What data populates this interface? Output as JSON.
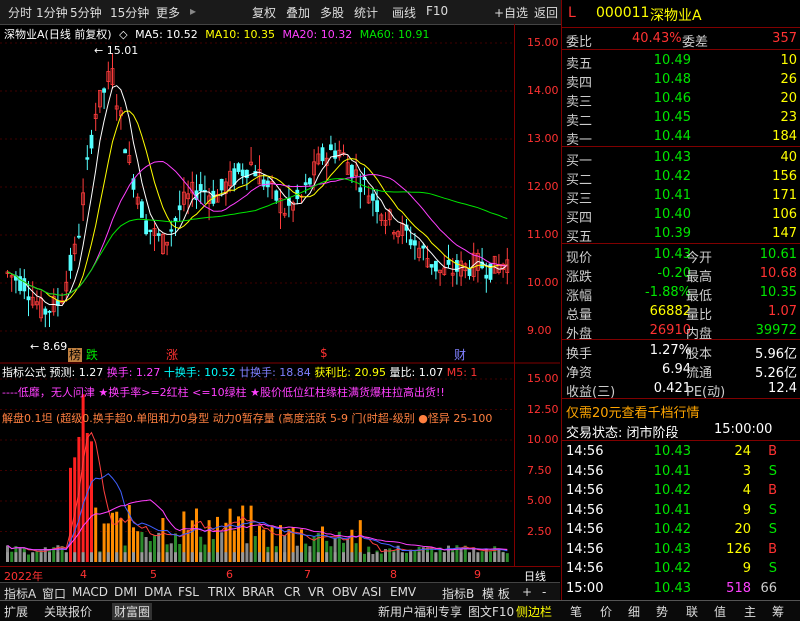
{
  "toolbar": {
    "items": [
      "分时",
      "1分钟",
      "5分钟",
      "15分钟",
      "更多",
      "复权",
      "叠加",
      "多股",
      "统计",
      "画线",
      "F10",
      "+自选",
      "返回"
    ]
  },
  "quote_header": {
    "prefix": "L",
    "code": "000011",
    "name": "深物业A"
  },
  "chart_header": {
    "title": "深物业A(日线 前复权)",
    "ma5": "MA5: 10.52",
    "ma10": "MA10: 10.35",
    "ma20": "MA20: 10.32",
    "ma60": "MA60: 10.91"
  },
  "price_axis": [
    "15.00",
    "14.00",
    "13.00",
    "12.00",
    "11.00",
    "10.00",
    "9.00"
  ],
  "annotations": {
    "high": "15.01",
    "low": "8.69"
  },
  "markers": [
    "榜",
    "跌",
    "涨",
    "$",
    "财"
  ],
  "indicator_header": {
    "name": "指标公式",
    "pred": "预测: 1.27",
    "hs": "换手: 1.27",
    "hs10": "十换手: 10.52",
    "hs20": "廿换手: 18.84",
    "profit": "获利比: 20.95",
    "lb": "量比: 1.07",
    "m5": "M5: 1"
  },
  "indicator_axis": [
    "15.00",
    "12.50",
    "10.00",
    "7.50",
    "5.00",
    "2.50"
  ],
  "indicator_notes": {
    "line1": "----低靡，无人问津 ★换手率>=2红柱 <=10绿柱 ★股价低位红柱缘柱满货爆柱拉高出货!!",
    "line2": "解盘0.1坦 (超级0.换手超0.单阻和力0身型 动力0暂存量 (高度活跃 5-9 门(时超-级别 ●怪异 25-100"
  },
  "time_axis": [
    "2022年",
    "4",
    "5",
    "6",
    "7",
    "8",
    "9",
    "日线"
  ],
  "tabs": [
    "指标A",
    "窗口",
    "MACD",
    "DMI",
    "DMA",
    "FSL",
    "TRIX",
    "BRAR",
    "CR",
    "VR",
    "OBV",
    "ASI",
    "EMV",
    "指标B",
    "模 板",
    "+",
    "-"
  ],
  "footer": {
    "left": [
      "扩展",
      "关联报价",
      "财富圈"
    ],
    "center": [
      "新用户福利专享",
      "图文F10",
      "侧边栏"
    ],
    "right": [
      "笔",
      "价",
      "细",
      "势",
      "联",
      "值",
      "主",
      "筹"
    ]
  },
  "order_book": {
    "wb_label": "委比",
    "wb_value": "40.43%",
    "wc_label": "委差",
    "wc_value": "357",
    "sells": [
      {
        "label": "卖五",
        "price": "10.49",
        "vol": "10"
      },
      {
        "label": "卖四",
        "price": "10.48",
        "vol": "26"
      },
      {
        "label": "卖三",
        "price": "10.46",
        "vol": "20"
      },
      {
        "label": "卖二",
        "price": "10.45",
        "vol": "23"
      },
      {
        "label": "卖一",
        "price": "10.44",
        "vol": "184"
      }
    ],
    "buys": [
      {
        "label": "买一",
        "price": "10.43",
        "vol": "40"
      },
      {
        "label": "买二",
        "price": "10.42",
        "vol": "156"
      },
      {
        "label": "买三",
        "price": "10.41",
        "vol": "171"
      },
      {
        "label": "买四",
        "price": "10.40",
        "vol": "106"
      },
      {
        "label": "买五",
        "price": "10.39",
        "vol": "147"
      }
    ]
  },
  "stats": [
    {
      "l1": "现价",
      "v1": "10.43",
      "l2": "今开",
      "v2": "10.61"
    },
    {
      "l1": "涨跌",
      "v1": "-0.20",
      "l2": "最高",
      "v2": "10.68"
    },
    {
      "l1": "涨幅",
      "v1": "-1.88%",
      "l2": "最低",
      "v2": "10.35"
    },
    {
      "l1": "总量",
      "v1": "66882",
      "l2": "量比",
      "v2": "1.07"
    },
    {
      "l1": "外盘",
      "v1": "26910",
      "l2": "内盘",
      "v2": "39972"
    }
  ],
  "stats2": [
    {
      "l1": "换手",
      "v1": "1.27%",
      "l2": "股本",
      "v2": "5.96亿"
    },
    {
      "l1": "净资",
      "v1": "6.94",
      "l2": "流通",
      "v2": "5.26亿"
    },
    {
      "l1": "收益(三)",
      "v1": "0.421",
      "l2": "PE(动)",
      "v2": "12.4"
    }
  ],
  "promo": "仅需20元查看千档行情",
  "trade_status": {
    "label": "交易状态: 闭市阶段",
    "time": "15:00:00"
  },
  "ticks": [
    {
      "t": "14:56",
      "p": "10.43",
      "v": "24",
      "d": "B"
    },
    {
      "t": "14:56",
      "p": "10.41",
      "v": "3",
      "d": "S"
    },
    {
      "t": "14:56",
      "p": "10.42",
      "v": "4",
      "d": "B"
    },
    {
      "t": "14:56",
      "p": "10.41",
      "v": "9",
      "d": "S"
    },
    {
      "t": "14:56",
      "p": "10.42",
      "v": "20",
      "d": "S"
    },
    {
      "t": "14:56",
      "p": "10.43",
      "v": "126",
      "d": "B"
    },
    {
      "t": "14:56",
      "p": "10.42",
      "v": "9",
      "d": "S"
    },
    {
      "t": "15:00",
      "p": "10.43",
      "v": "518",
      "d": "66"
    }
  ]
}
